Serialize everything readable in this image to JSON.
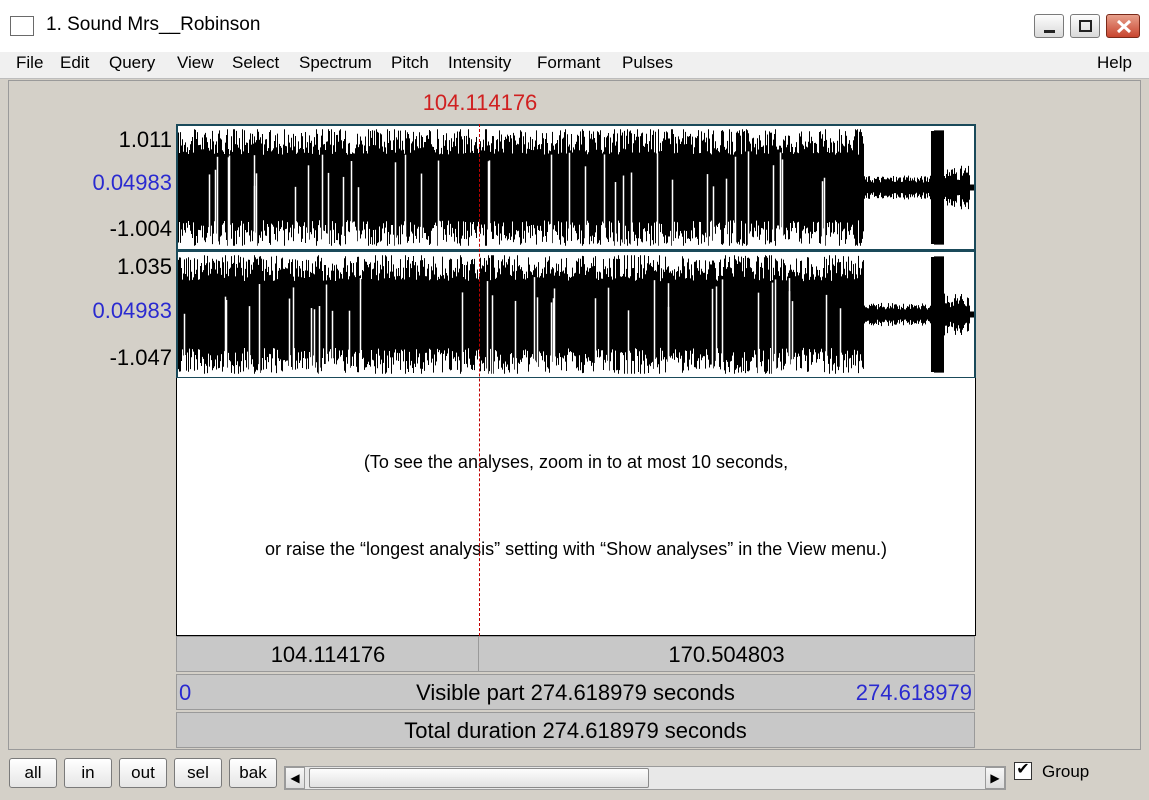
{
  "window": {
    "title": "1. Sound Mrs__Robinson"
  },
  "menu": [
    "File",
    "Edit",
    "Query",
    "View",
    "Select",
    "Spectrum",
    "Pitch",
    "Intensity",
    "Formant",
    "Pulses"
  ],
  "menu_help": "Help",
  "cursor": {
    "time": "104.114176"
  },
  "channel1": {
    "max": "1.011",
    "center": "0.04983",
    "min": "-1.004"
  },
  "channel2": {
    "max": "1.035",
    "center": "0.04983",
    "min": "-1.047"
  },
  "analysis_message": {
    "line1": "(To see the analyses, zoom in to at most 10 seconds,",
    "line2": "or raise the “longest analysis” setting with “Show analyses” in the View menu.)"
  },
  "time_bars": {
    "left_part": "104.114176",
    "right_part": "170.504803",
    "visible_start": "0",
    "visible_label": "Visible part 274.618979 seconds",
    "visible_end": "274.618979",
    "total_label": "Total duration 274.618979 seconds"
  },
  "zoom_buttons": [
    "all",
    "in",
    "out",
    "sel",
    "bak"
  ],
  "group": {
    "label": "Group",
    "checked": true
  },
  "colors": {
    "cursor": "#d02020",
    "value_blue": "#2a2ad0",
    "panel_border": "#1a4a5a"
  }
}
